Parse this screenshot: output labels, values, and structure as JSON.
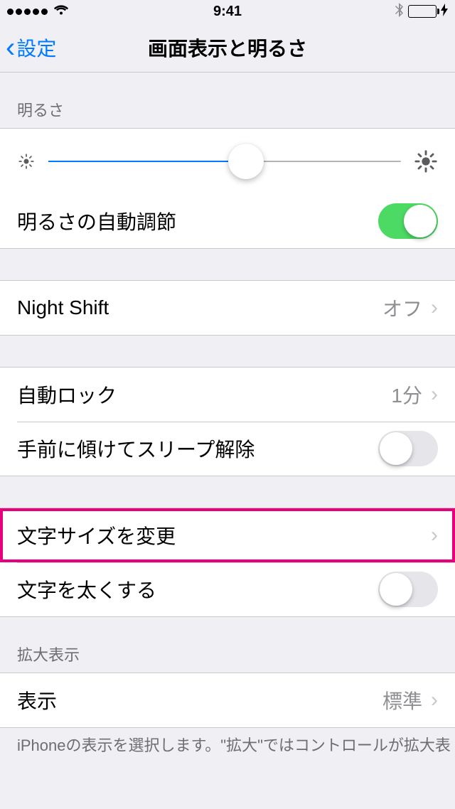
{
  "status": {
    "time": "9:41"
  },
  "nav": {
    "back": "設定",
    "title": "画面表示と明るさ"
  },
  "brightness": {
    "header": "明るさ",
    "slider_pct": 56,
    "auto_label": "明るさの自動調節",
    "auto_on": true
  },
  "night_shift": {
    "label": "Night Shift",
    "value": "オフ"
  },
  "auto_lock": {
    "label": "自動ロック",
    "value": "1分"
  },
  "raise_to_wake": {
    "label": "手前に傾けてスリープ解除",
    "on": false
  },
  "text_size": {
    "label": "文字サイズを変更"
  },
  "bold_text": {
    "label": "文字を太くする",
    "on": false
  },
  "zoom": {
    "header": "拡大表示",
    "view_label": "表示",
    "view_value": "標準",
    "footer": "iPhoneの表示を選択します。\"拡大\"ではコントロールが拡大表"
  }
}
